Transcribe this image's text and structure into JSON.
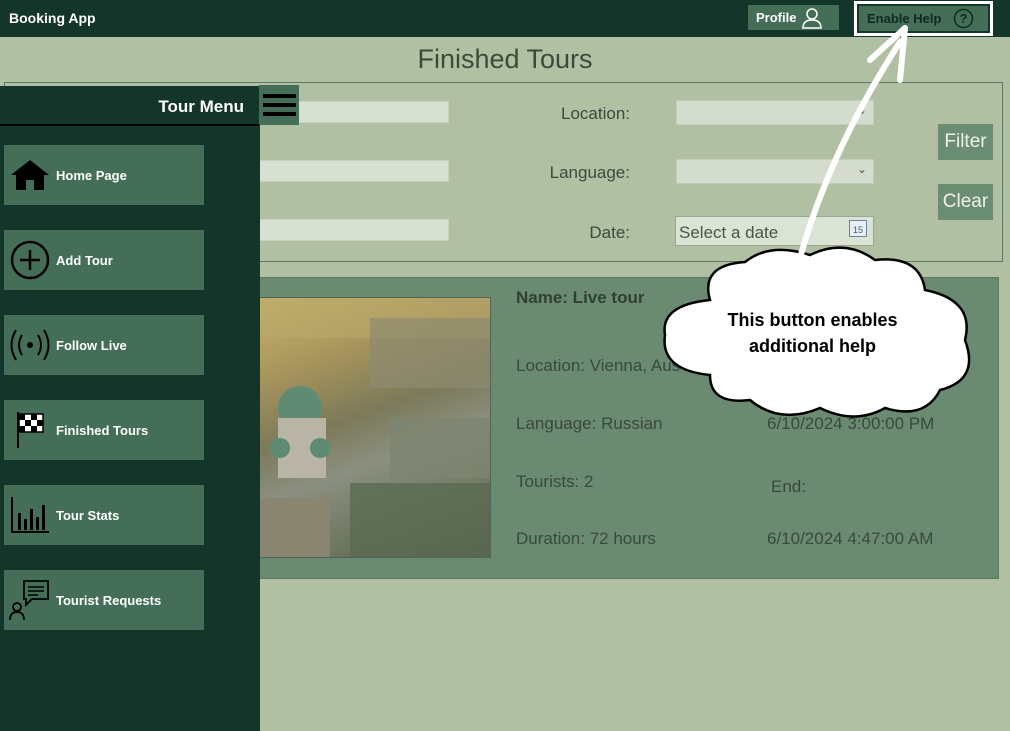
{
  "app": {
    "title": "Booking App"
  },
  "header": {
    "profile_label": "Profile",
    "help_label": "Enable Help"
  },
  "page": {
    "title": "Finished Tours"
  },
  "filters": {
    "location_label": "Location:",
    "language_label": "Language:",
    "date_label": "Date:",
    "date_placeholder": "Select a date",
    "calendar_day": "15",
    "filter_button": "Filter",
    "clear_button": "Clear"
  },
  "tour": {
    "name": "Name: Live tour",
    "location": "Location: Vienna, Aus",
    "language": "Language: Russian",
    "tourists": "Tourists: 2",
    "duration": "Duration: 72 hours",
    "start": "6/10/2024 3:00:00 PM",
    "end_label": "End:",
    "end": "6/10/2024 4:47:00 AM"
  },
  "menu": {
    "title": "Tour Menu",
    "items": [
      {
        "label": "Home Page",
        "icon": "house-icon"
      },
      {
        "label": "Add Tour",
        "icon": "plus-circle-icon"
      },
      {
        "label": "Follow Live",
        "icon": "broadcast-icon"
      },
      {
        "label": "Finished Tours",
        "icon": "checkered-flag-icon"
      },
      {
        "label": "Tour Stats",
        "icon": "bar-chart-icon"
      },
      {
        "label": "Tourist Requests",
        "icon": "person-message-icon"
      }
    ]
  },
  "callout": {
    "text": "This button enables additional help"
  },
  "colors": {
    "dark": "#143529",
    "button": "#456e59",
    "background": "#b1c0a2",
    "card": "#6a8b71"
  }
}
